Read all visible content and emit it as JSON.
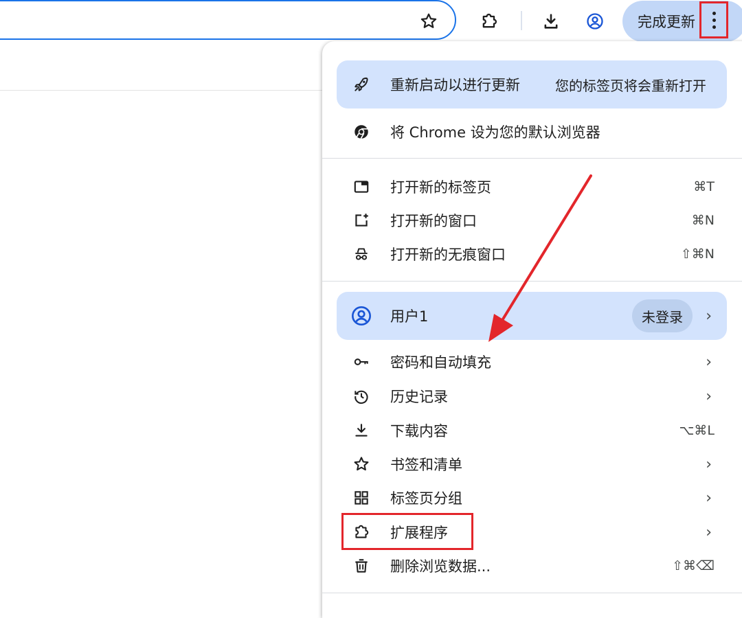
{
  "toolbar": {
    "update_label": "完成更新",
    "icons": [
      "star-icon",
      "extension-icon",
      "download-icon",
      "profile-icon",
      "more-vert-icon"
    ]
  },
  "menu": {
    "update_row": {
      "label": "重新启动以进行更新",
      "note": "您的标签页将会重新打开",
      "icon": "rocket-icon"
    },
    "default_browser": {
      "label": "将 Chrome 设为您的默认浏览器",
      "icon": "chrome-icon"
    },
    "new_tab": {
      "label": "打开新的标签页",
      "shortcut": "⌘T",
      "icon": "new-tab-icon"
    },
    "new_window": {
      "label": "打开新的窗口",
      "shortcut": "⌘N",
      "icon": "new-window-icon"
    },
    "incognito": {
      "label": "打开新的无痕窗口",
      "shortcut": "⇧⌘N",
      "icon": "incognito-icon"
    },
    "profile": {
      "label": "用户1",
      "badge": "未登录",
      "chevron": "›",
      "icon": "profile-icon"
    },
    "passwords": {
      "label": "密码和自动填充",
      "chevron": "›",
      "icon": "key-icon"
    },
    "history": {
      "label": "历史记录",
      "chevron": "›",
      "icon": "history-icon"
    },
    "downloads": {
      "label": "下载内容",
      "shortcut": "⌥⌘L",
      "icon": "download-icon"
    },
    "bookmarks": {
      "label": "书签和清单",
      "chevron": "›",
      "icon": "star-icon"
    },
    "tab_groups": {
      "label": "标签页分组",
      "chevron": "›",
      "icon": "tab-groups-icon"
    },
    "extensions": {
      "label": "扩展程序",
      "chevron": "›",
      "icon": "extension-icon"
    },
    "clear_data": {
      "label": "删除浏览数据...",
      "shortcut": "⇧⌘⌫",
      "icon": "trash-icon"
    }
  },
  "colors": {
    "accent": "#1a73e8",
    "highlight_pill": "#d3e3fd",
    "update_pill": "#c2d7f7",
    "annotation_red": "#e3262b"
  }
}
